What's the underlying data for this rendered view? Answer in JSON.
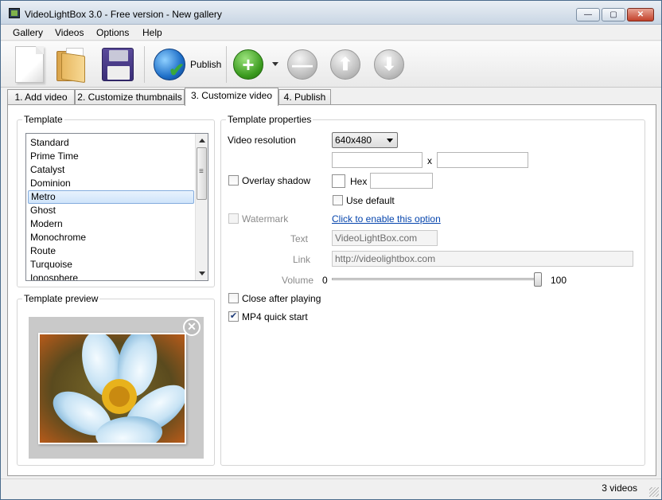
{
  "window": {
    "title": "VideoLightBox 3.0 - Free version - New gallery",
    "controls": {
      "minimize": "—",
      "maximize": "▢",
      "close": "✕"
    }
  },
  "menu": [
    "Gallery",
    "Videos",
    "Options",
    "Help"
  ],
  "toolbar": {
    "publish_label": "Publish",
    "icons": [
      "new-document-icon",
      "open-folder-icon",
      "save-disk-icon",
      "publish-globe-icon",
      "add-icon",
      "remove-icon",
      "move-up-icon",
      "move-down-icon"
    ],
    "add_symbol": "+",
    "remove_symbol": "—",
    "up_symbol": "⬆",
    "down_symbol": "⬇"
  },
  "tabs": [
    {
      "label": "1. Add video",
      "active": false
    },
    {
      "label": "2. Customize thumbnails",
      "active": false
    },
    {
      "label": "3. Customize video",
      "active": true
    },
    {
      "label": "4. Publish",
      "active": false
    }
  ],
  "template": {
    "title": "Template",
    "items": [
      "Standard",
      "Prime Time",
      "Catalyst",
      "Dominion",
      "Metro",
      "Ghost",
      "Modern",
      "Monochrome",
      "Route",
      "Turquoise",
      "Ionosphere"
    ],
    "selected": "Metro"
  },
  "preview": {
    "title": "Template preview",
    "close_symbol": "✕"
  },
  "properties": {
    "title": "Template properties",
    "video_resolution_label": "Video resolution",
    "video_resolution_value": "640x480",
    "width_value": "",
    "height_value": "",
    "size_separator": "x",
    "overlay_shadow_label": "Overlay shadow",
    "overlay_shadow_checked": false,
    "hex_label": "Hex",
    "hex_value": "",
    "use_default_label": "Use default",
    "use_default_checked": false,
    "watermark_label": "Watermark",
    "watermark_checked": false,
    "watermark_link": "Click to enable this option",
    "text_label": "Text",
    "text_value": "VideoLightBox.com",
    "link_label": "Link",
    "link_value": "http://videolightbox.com",
    "volume_label": "Volume",
    "volume_min": "0",
    "volume_max": "100",
    "volume_value": 100,
    "close_after_playing_label": "Close after playing",
    "close_after_playing_checked": false,
    "mp4_quick_start_label": "MP4 quick start",
    "mp4_quick_start_checked": true,
    "check_mark": "✔"
  },
  "status": {
    "text": "3 videos"
  },
  "colors": {
    "accent": "#84acdd",
    "link": "#0645ad",
    "add_green": "#3a9a1e"
  }
}
